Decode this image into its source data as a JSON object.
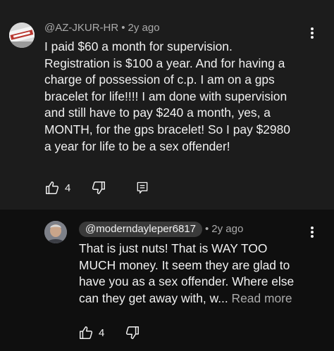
{
  "comment": {
    "handle": "@AZ-JKUR-HR",
    "separator": "•",
    "age": "2y ago",
    "text": "I paid $60 a month for supervision.\nRegistration is $100 a year. And for having a\ncharge of possession of c.p. I am on a gps\nbracelet for life!!!! I am done with supervision\nand still have to pay $240 a month, yes, a\nMONTH, for the gps bracelet!  So I pay $2980\na year for life to be a sex offender!",
    "likes": "4",
    "icons": {
      "like": "thumbs-up-icon",
      "dislike": "thumbs-down-icon",
      "reply": "comment-reply-icon",
      "menu": "more-vertical-icon"
    }
  },
  "reply": {
    "handle": "@moderndayleper6817",
    "separator": "•",
    "age": "2y ago",
    "text": "That is just nuts! That is WAY TOO\nMUCH money. It seem they are glad to\nhave you as a sex offender. Where else\ncan they get away with, w...",
    "read_more": "Read more",
    "likes": "4",
    "icons": {
      "like": "thumbs-up-icon",
      "dislike": "thumbs-down-icon",
      "menu": "more-vertical-icon"
    }
  },
  "colors": {
    "background": "#0f0f0f",
    "main_comment_panel": "#1c1c1c",
    "text_primary": "#f1f1f1",
    "text_secondary": "#aaaaaa",
    "handle_chip": "#3a3a3a"
  }
}
